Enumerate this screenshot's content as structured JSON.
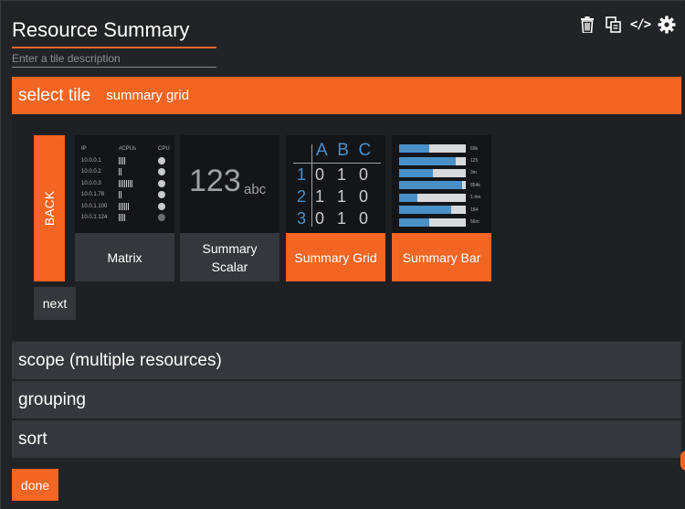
{
  "header": {
    "title": "Resource Summary",
    "description_placeholder": "Enter a tile description",
    "tools": [
      {
        "icon": "trash-icon"
      },
      {
        "icon": "copy-icon"
      },
      {
        "icon": "code-icon",
        "glyph": "</>"
      },
      {
        "icon": "gear-icon"
      }
    ]
  },
  "select_tile": {
    "label": "select tile",
    "current": "summary grid",
    "back_label": "BACK",
    "next_label": "next",
    "tiles": [
      {
        "caption": "Matrix",
        "selected": false
      },
      {
        "caption": "Summary Scalar",
        "selected": false
      },
      {
        "caption": "Summary Grid",
        "selected": true
      },
      {
        "caption": "Summary Bar",
        "selected": true
      }
    ]
  },
  "previews": {
    "matrix": {
      "headers": [
        "IP",
        "#CPUs",
        "CPU"
      ],
      "rows": [
        {
          "ip": "10.0.0.1",
          "cpus": 4,
          "dim": false
        },
        {
          "ip": "10.0.0.2",
          "cpus": 2,
          "dim": false
        },
        {
          "ip": "10.0.0.3",
          "cpus": 8,
          "dim": false
        },
        {
          "ip": "10.0.1.78",
          "cpus": 2,
          "dim": false
        },
        {
          "ip": "10.0.1.100",
          "cpus": 6,
          "dim": false
        },
        {
          "ip": "10.0.1.124",
          "cpus": 4,
          "dim": true
        }
      ]
    },
    "scalar": {
      "number": "123",
      "text": "abc"
    },
    "grid": {
      "columns": [
        "A",
        "B",
        "C"
      ],
      "rows": [
        {
          "label": "1",
          "values": [
            "0",
            "1",
            "0"
          ]
        },
        {
          "label": "2",
          "values": [
            "1",
            "1",
            "0"
          ]
        },
        {
          "label": "3",
          "values": [
            "0",
            "1",
            "0"
          ]
        }
      ]
    },
    "bar": {
      "rows": [
        {
          "fill": 0.45,
          "value": "66k"
        },
        {
          "fill": 0.85,
          "value": "125"
        },
        {
          "fill": 0.5,
          "value": "3m"
        },
        {
          "fill": 0.95,
          "value": "854k"
        },
        {
          "fill": 0.28,
          "value": "1.4m"
        },
        {
          "fill": 0.78,
          "value": "184"
        },
        {
          "fill": 0.45,
          "value": "56m"
        }
      ]
    }
  },
  "sections": [
    {
      "label": "scope (multiple resources)"
    },
    {
      "label": "grouping"
    },
    {
      "label": "sort"
    }
  ],
  "done_label": "done",
  "colors": {
    "accent": "#f26522",
    "panel": "#36373c",
    "background": "#1e1f23",
    "chart_blue": "#4a90c8"
  }
}
